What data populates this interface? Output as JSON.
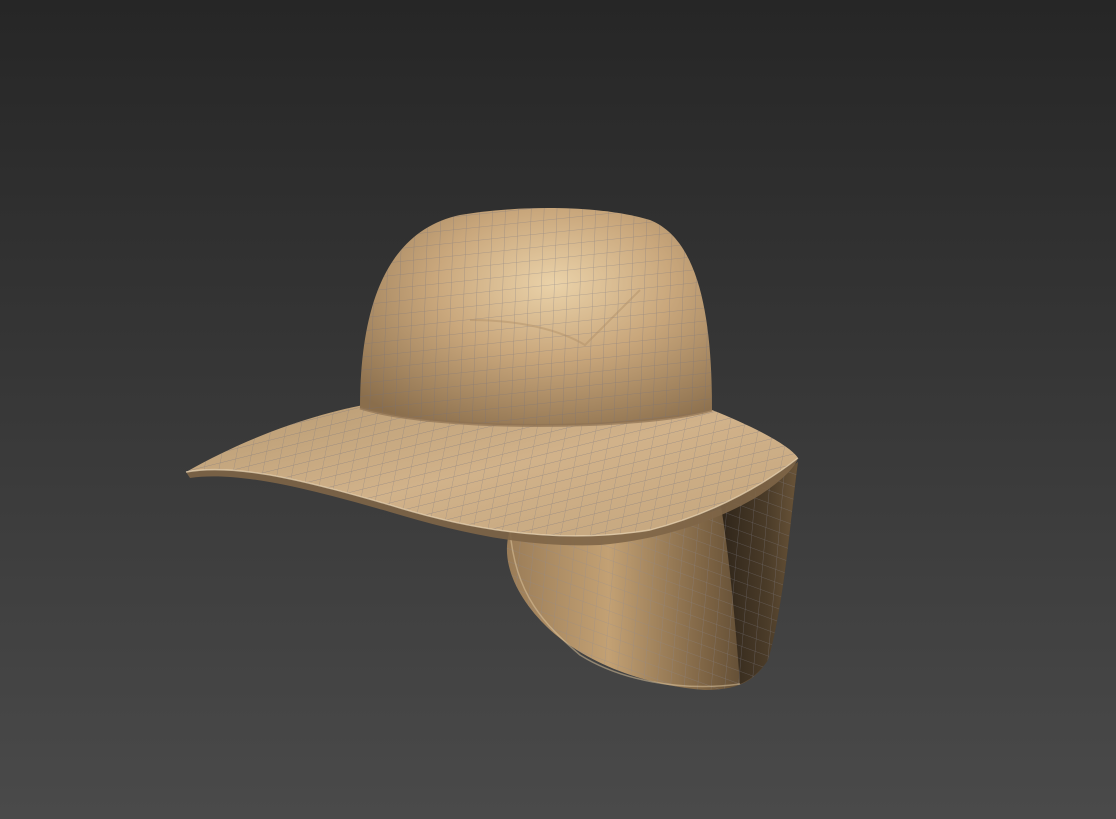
{
  "viewport": {
    "background": {
      "top": "#262626",
      "bottom": "#4a4a4a"
    }
  },
  "model": {
    "object": "brimmed-hat-with-neck-flap",
    "shading": "smooth-with-edged-faces",
    "colors": {
      "base": "#c4a47c",
      "highlight": "#e8cfa6",
      "shadow": "#4a3a26",
      "wire": "#7a7a88"
    }
  }
}
